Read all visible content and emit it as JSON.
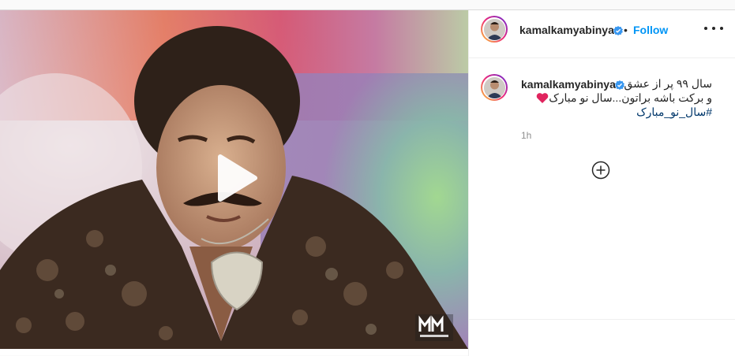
{
  "post": {
    "username": "kamalkamyabinya",
    "follow_label": "Follow",
    "separator": "•",
    "caption_lines": [
      "سال ۹۹ پر از عشق",
      "و برکت باشه براتون...سال نو مبارک"
    ],
    "hashtag": "#سال_نو_مبارک",
    "time_ago": "1h",
    "media_type": "video",
    "watermark_text": "MM"
  },
  "colors": {
    "follow": "#0095f6",
    "verified": "#3897f0",
    "heart": "#e0245e",
    "hashtag": "#00376b"
  },
  "icons": {
    "play": "play-icon",
    "more": "more-options-icon",
    "verified": "verified-badge-icon",
    "load_more": "plus-circle-icon",
    "heart": "red-heart-emoji"
  }
}
